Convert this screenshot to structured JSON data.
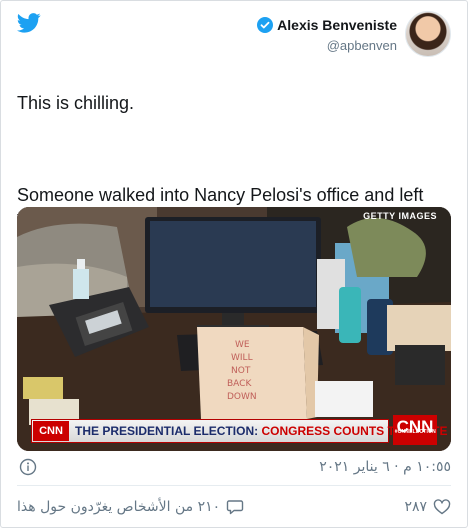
{
  "colors": {
    "twitter_blue": "#1da1f2",
    "cnn_red": "#cc0000",
    "chyron_blue": "#1c2c6b"
  },
  "author": {
    "name": "Alexis Benveniste",
    "handle": "@apbenven",
    "verified": true,
    "avatar": "avatar-photo"
  },
  "tweet": {
    "line1": "This is chilling.",
    "line2": "Someone walked into Nancy Pelosi's office and left this note on her desk: \"WE WILL NOT BACK DOWN.\""
  },
  "photo": {
    "credit": "GETTY IMAGES",
    "note_text": [
      "WE",
      "WILL",
      "NOT",
      "BACK",
      "DOWN"
    ],
    "chyron": {
      "network": "CNN",
      "headline_part1": "THE PRESIDENTIAL ELECTION:",
      "headline_part2": "CONGRESS COUNTS THE VOTE",
      "tag": "#CNNELECTION"
    }
  },
  "meta": {
    "timestamp": "١٠:٥٥ م · ٦ يناير ٢٠٢١"
  },
  "actions": {
    "talking": "٢١٠ من الأشخاص يغرّدون حول هذا",
    "likes": "٢٨٧"
  },
  "icons": [
    "twitter-bird-icon",
    "verified-badge-icon",
    "info-icon",
    "comment-icon",
    "heart-icon"
  ]
}
